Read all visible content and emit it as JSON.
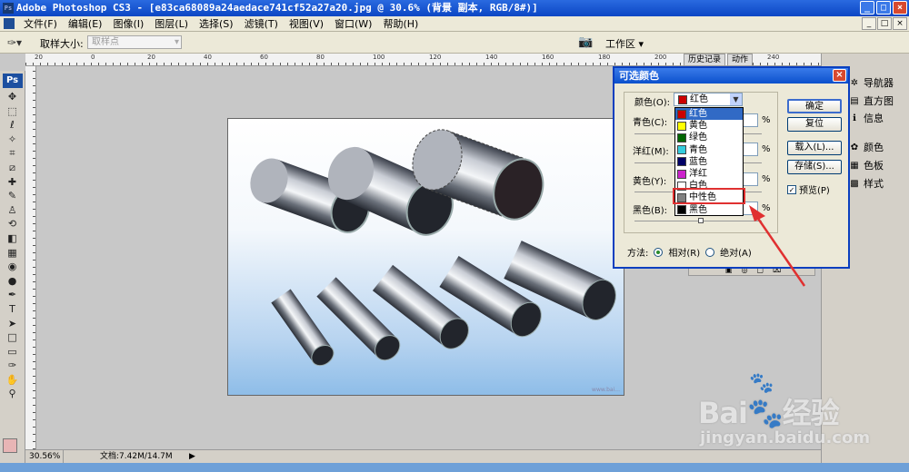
{
  "window": {
    "title": "Adobe Photoshop CS3 - [e83ca68089a24aedace741cf52a27a20.jpg @ 30.6% (背景 副本, RGB/8#)]",
    "controls": [
      "_",
      "□",
      "×"
    ]
  },
  "menu": [
    "文件(F)",
    "编辑(E)",
    "图像(I)",
    "图层(L)",
    "选择(S)",
    "滤镜(T)",
    "视图(V)",
    "窗口(W)",
    "帮助(H)"
  ],
  "options": {
    "sample_size_label": "取样大小:",
    "sample_size_value": "取样点",
    "workspace": "工作区 ▾"
  },
  "toolbox": {
    "logo": "Ps",
    "tools": [
      "move",
      "marquee",
      "lasso",
      "magic-wand",
      "crop",
      "slice",
      "healing",
      "brush",
      "stamp",
      "history-brush",
      "eraser",
      "gradient",
      "blur",
      "dodge",
      "pen",
      "type",
      "path-select",
      "shape",
      "notes",
      "eyedropper",
      "hand",
      "zoom"
    ],
    "tool_glyphs": [
      "✥",
      "⬚",
      "ℓ",
      "✧",
      "⌗",
      "⧄",
      "✚",
      "✎",
      "♙",
      "⟲",
      "◧",
      "▦",
      "◉",
      "●",
      "✒",
      "T",
      "➤",
      "□",
      "▭",
      "✑",
      "✋",
      "⚲"
    ]
  },
  "ruler_ticks": [
    "20",
    "0",
    "20",
    "40",
    "60",
    "80",
    "100",
    "120",
    "140",
    "160",
    "180",
    "200",
    "220",
    "240"
  ],
  "status": {
    "zoom": "30.56%",
    "doc": "文档:7.42M/14.7M"
  },
  "history_tabs": [
    "历史记录",
    "动作"
  ],
  "panels": [
    {
      "label": "导航器",
      "icon": "✲"
    },
    {
      "label": "直方图",
      "icon": "▤"
    },
    {
      "label": "信息",
      "icon": "ℹ"
    },
    {
      "label": "颜色",
      "icon": "✿"
    },
    {
      "label": "色板",
      "icon": "▦"
    },
    {
      "label": "样式",
      "icon": "▩"
    }
  ],
  "dialog": {
    "title": "可选颜色",
    "colors_label": "颜色(O):",
    "selected_color": "红色",
    "fields": [
      {
        "label": "青色(C):",
        "unit": "%"
      },
      {
        "label": "洋红(M):",
        "unit": "%"
      },
      {
        "label": "黄色(Y):",
        "unit": "%"
      },
      {
        "label": "黑色(B):",
        "unit": "%"
      }
    ],
    "buttons": {
      "ok": "确定",
      "reset": "复位",
      "load": "载入(L)...",
      "save": "存储(S)..."
    },
    "preview": {
      "label": "预览(P)",
      "checked": true
    },
    "method_label": "方法:",
    "method_relative": "相对(R)",
    "method_absolute": "绝对(A)",
    "color_options": [
      {
        "label": "红色",
        "color": "#cc0000"
      },
      {
        "label": "黄色",
        "color": "#ffff00"
      },
      {
        "label": "绿色",
        "color": "#006600"
      },
      {
        "label": "青色",
        "color": "#33ccdd"
      },
      {
        "label": "蓝色",
        "color": "#000066"
      },
      {
        "label": "洋红",
        "color": "#cc22cc"
      },
      {
        "label": "白色",
        "color": "#ffffff"
      },
      {
        "label": "中性色",
        "color": "#808080"
      },
      {
        "label": "黑色",
        "color": "#000000"
      }
    ],
    "highlighted_option": "中性色"
  },
  "image_watermark": "www.bai...",
  "watermark": {
    "main": "Bai🐾经验",
    "sub": "jingyan.baidu.com"
  }
}
